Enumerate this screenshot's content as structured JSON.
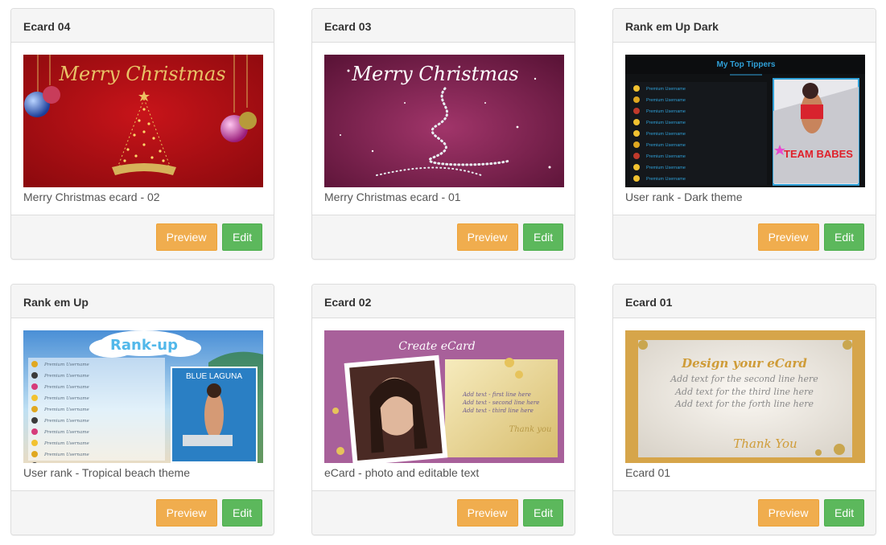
{
  "cards": [
    {
      "title": "Ecard 04",
      "caption": "Merry Christmas ecard - 02",
      "image_text": "Merry Christmas",
      "preview_label": "Preview",
      "edit_label": "Edit"
    },
    {
      "title": "Ecard 03",
      "caption": "Merry Christmas ecard - 01",
      "image_text": "Merry Christmas",
      "preview_label": "Preview",
      "edit_label": "Edit"
    },
    {
      "title": "Rank em Up Dark",
      "caption": "User rank - Dark theme",
      "image_text": "My Top Tippers",
      "image_text_2": "TEAM BABES",
      "rank_rows": [
        "Premium Username",
        "Premium Username",
        "Premium Username",
        "Premium Username",
        "Premium Username",
        "Premium Username",
        "Premium Username",
        "Premium Username",
        "Premium Username"
      ],
      "preview_label": "Preview",
      "edit_label": "Edit"
    },
    {
      "title": "Rank em Up",
      "caption": "User rank - Tropical beach theme",
      "image_text": "Rank-up",
      "image_text_2": "BLUE LAGUNA",
      "rank_rows": [
        "Premium Username",
        "Premium Username",
        "Premium Username",
        "Premium Username",
        "Premium Username",
        "Premium Username",
        "Premium Username",
        "Premium Username",
        "Premium Username",
        "Premium Username"
      ],
      "preview_label": "Preview",
      "edit_label": "Edit"
    },
    {
      "title": "Ecard 02",
      "caption": "eCard - photo and editable text",
      "image_text": "Create eCard",
      "image_lines": [
        "Add text - first line here",
        "Add text - second line here",
        "Add text - third line here"
      ],
      "image_text_2": "Thank you",
      "preview_label": "Preview",
      "edit_label": "Edit"
    },
    {
      "title": "Ecard 01",
      "caption": "Ecard 01",
      "image_text": "Design your eCard",
      "image_lines": [
        "Add text for the second line here",
        "Add text for the third line here",
        "Add text for the forth line here"
      ],
      "image_text_2": "Thank You",
      "preview_label": "Preview",
      "edit_label": "Edit"
    }
  ],
  "colors": {
    "preview_button": "#f0ad4e",
    "edit_button": "#5cb85c",
    "panel_header": "#f5f5f5",
    "border": "#dddddd"
  }
}
